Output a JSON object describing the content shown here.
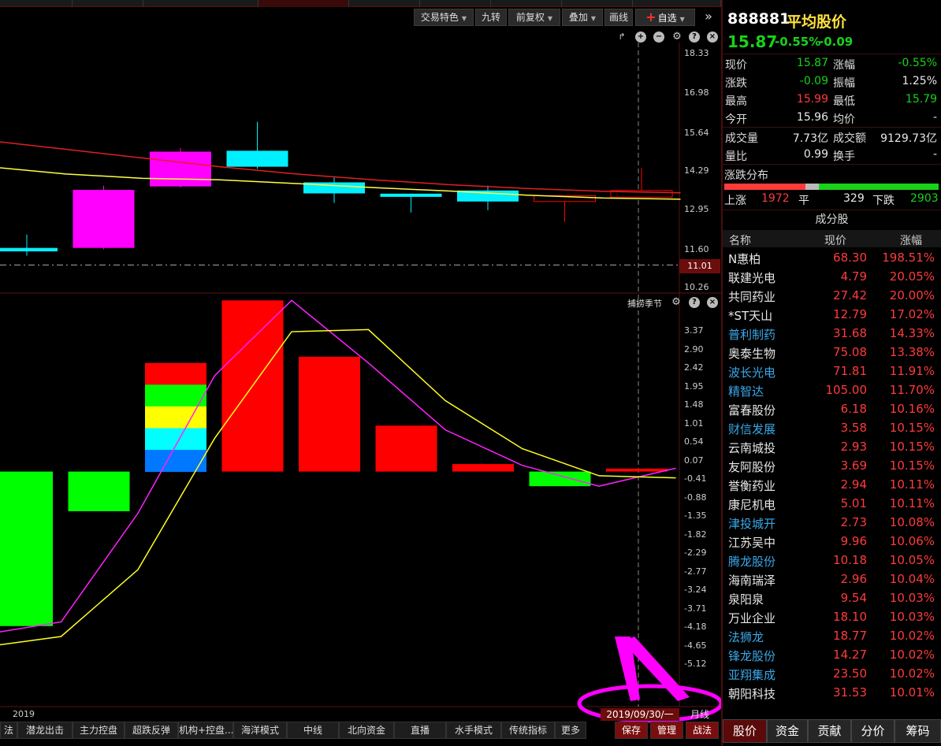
{
  "toolbar": {
    "trade_features": "交易特色",
    "nine_turns": "九转",
    "adjust": "前复权",
    "overlay": "叠加",
    "draw_line": "画线",
    "watchlist": "自选"
  },
  "price_axis": [
    "18.33",
    "16.98",
    "15.64",
    "14.29",
    "12.95",
    "11.60",
    "10.26"
  ],
  "current_price_tag": "11.01",
  "indicator": {
    "name": "捕捞季节",
    "axis": [
      "3.37",
      "2.90",
      "2.42",
      "1.95",
      "1.48",
      "1.01",
      "0.54",
      "0.07",
      "-0.41",
      "-0.88",
      "-1.35",
      "-1.82",
      "-2.29",
      "-2.77",
      "-3.24",
      "-3.71",
      "-4.18",
      "-4.65",
      "-5.12"
    ]
  },
  "timeline": {
    "year_label": "2019",
    "cursor_date": "2019/09/30/一",
    "period": "月线"
  },
  "bottom_tabs": [
    "法",
    "潜龙出击",
    "主力控盘",
    "超跌反弹",
    "机构+控盘...",
    "海洋模式",
    "中线",
    "北向资金",
    "直播",
    "水手模式",
    "传统指标",
    "更多"
  ],
  "bottom_actions": [
    "保存",
    "管理",
    "战法"
  ],
  "right_tabs": [
    "股价",
    "资金",
    "贡献",
    "分价",
    "筹码"
  ],
  "quote": {
    "code": "888881",
    "name": "平均股价",
    "price": "15.87",
    "change_pct": "-0.55%",
    "change": "-0.09",
    "stats": [
      {
        "l1": "现价",
        "v1": "15.87",
        "c1": "g",
        "l2": "涨幅",
        "v2": "-0.55%",
        "c2": "g"
      },
      {
        "l1": "涨跌",
        "v1": "-0.09",
        "c1": "g",
        "l2": "振幅",
        "v2": "1.25%",
        "c2": "w"
      },
      {
        "l1": "最高",
        "v1": "15.99",
        "c1": "r",
        "l2": "最低",
        "v2": "15.79",
        "c2": "g"
      },
      {
        "l1": "今开",
        "v1": "15.96",
        "c1": "w",
        "l2": "均价",
        "v2": "-",
        "c2": "w"
      }
    ],
    "stats2": [
      {
        "l1": "成交量",
        "v1": "7.73亿",
        "c1": "w",
        "l2": "成交额",
        "v2": "9129.73亿",
        "c2": "w"
      },
      {
        "l1": "量比",
        "v1": "0.99",
        "c1": "w",
        "l2": "换手",
        "v2": "-",
        "c2": "w"
      }
    ]
  },
  "distribution": {
    "title": "涨跌分布",
    "up_label": "上涨",
    "up": "1972",
    "flat_label": "平",
    "flat": "329",
    "down_label": "下跌",
    "down": "2903",
    "up_frac": 0.379,
    "flat_frac": 0.063,
    "down_frac": 0.558
  },
  "constituents": {
    "title": "成分股",
    "headers": [
      "名称",
      "现价",
      "涨幅"
    ],
    "rows": [
      {
        "name": "N惠柏",
        "price": "68.30",
        "pct": "198.51%",
        "color": "white"
      },
      {
        "name": "联建光电",
        "price": "4.79",
        "pct": "20.05%",
        "color": "white"
      },
      {
        "name": "共同药业",
        "price": "27.42",
        "pct": "20.00%",
        "color": "white"
      },
      {
        "name": "*ST天山",
        "price": "12.79",
        "pct": "17.02%",
        "color": "white"
      },
      {
        "name": "普利制药",
        "price": "31.68",
        "pct": "14.33%",
        "color": "blue"
      },
      {
        "name": "奥泰生物",
        "price": "75.08",
        "pct": "13.38%",
        "color": "white"
      },
      {
        "name": "波长光电",
        "price": "71.81",
        "pct": "11.91%",
        "color": "blue"
      },
      {
        "name": "精智达",
        "price": "105.00",
        "pct": "11.70%",
        "color": "blue"
      },
      {
        "name": "富春股份",
        "price": "6.18",
        "pct": "10.16%",
        "color": "white"
      },
      {
        "name": "财信发展",
        "price": "3.58",
        "pct": "10.15%",
        "color": "blue"
      },
      {
        "name": "云南城投",
        "price": "2.93",
        "pct": "10.15%",
        "color": "white"
      },
      {
        "name": "友阿股份",
        "price": "3.69",
        "pct": "10.15%",
        "color": "white"
      },
      {
        "name": "誉衡药业",
        "price": "2.94",
        "pct": "10.11%",
        "color": "white"
      },
      {
        "name": "康尼机电",
        "price": "5.01",
        "pct": "10.11%",
        "color": "white"
      },
      {
        "name": "津投城开",
        "price": "2.73",
        "pct": "10.08%",
        "color": "blue"
      },
      {
        "name": "江苏吴中",
        "price": "9.96",
        "pct": "10.06%",
        "color": "white"
      },
      {
        "name": "腾龙股份",
        "price": "10.18",
        "pct": "10.05%",
        "color": "blue"
      },
      {
        "name": "海南瑞泽",
        "price": "2.96",
        "pct": "10.04%",
        "color": "white"
      },
      {
        "name": "泉阳泉",
        "price": "9.54",
        "pct": "10.03%",
        "color": "white"
      },
      {
        "name": "万业企业",
        "price": "18.10",
        "pct": "10.03%",
        "color": "white"
      },
      {
        "name": "法狮龙",
        "price": "18.77",
        "pct": "10.02%",
        "color": "blue"
      },
      {
        "name": "锋龙股份",
        "price": "14.27",
        "pct": "10.02%",
        "color": "blue"
      },
      {
        "name": "亚翔集成",
        "price": "23.50",
        "pct": "10.02%",
        "color": "blue"
      },
      {
        "name": "朝阳科技",
        "price": "31.53",
        "pct": "10.01%",
        "color": "white"
      }
    ]
  },
  "colors": {
    "up": "#ff3b3b",
    "down": "#19d219",
    "accent": "#ff00ff",
    "ma_red": "#e02020",
    "ma_yellow": "#ffff40"
  },
  "chart_data": [
    {
      "type": "candlestick",
      "ylim": [
        10.26,
        18.33
      ],
      "candles": [
        {
          "o": 11.6,
          "c": 11.48,
          "h": 12.06,
          "l": 11.33,
          "col": "cyan"
        },
        {
          "o": 11.6,
          "c": 13.6,
          "h": 13.75,
          "l": 11.55,
          "col": "magenta"
        },
        {
          "o": 13.72,
          "c": 14.92,
          "h": 15.05,
          "l": 13.68,
          "col": "magenta"
        },
        {
          "o": 14.95,
          "c": 14.4,
          "h": 15.95,
          "l": 14.33,
          "col": "cyan"
        },
        {
          "o": 13.86,
          "c": 13.48,
          "h": 14.03,
          "l": 13.15,
          "col": "cyan"
        },
        {
          "o": 13.47,
          "c": 13.36,
          "h": 13.47,
          "l": 12.82,
          "col": "cyan"
        },
        {
          "o": 13.58,
          "c": 13.2,
          "h": 13.75,
          "l": 12.9,
          "col": "cyan"
        },
        {
          "o": 13.2,
          "c": 13.4,
          "h": 13.4,
          "l": 12.5,
          "col": "red"
        },
        {
          "o": 13.35,
          "c": 13.58,
          "h": 14.36,
          "l": 13.35,
          "col": "red"
        }
      ],
      "ma_red": [
        15.3,
        15.0,
        14.7,
        14.4,
        14.15,
        13.95,
        13.78,
        13.65,
        13.55,
        13.5
      ],
      "ma_yellow": [
        14.4,
        14.15,
        14.0,
        13.95,
        13.82,
        13.68,
        13.56,
        13.42,
        13.32,
        13.28
      ],
      "ref_price": 11.01
    },
    {
      "type": "bar",
      "ylim": [
        -5.12,
        3.37
      ],
      "bars": [
        {
          "v": -3.7,
          "col": "green"
        },
        {
          "v": -0.95,
          "col": "green"
        },
        {
          "v": 2.6,
          "col": "rainbow"
        },
        {
          "v": 4.1,
          "col": "red"
        },
        {
          "v": 2.75,
          "col": "red"
        },
        {
          "v": 1.1,
          "col": "red"
        },
        {
          "v": 0.18,
          "col": "red"
        },
        {
          "v": -0.35,
          "col": "green"
        },
        {
          "v": 0.07,
          "col": "red"
        }
      ],
      "line_magenta": [
        -3.9,
        -3.6,
        -1.0,
        2.3,
        4.1,
        2.6,
        1.0,
        0.15,
        -0.35,
        0.08
      ],
      "line_yellow": [
        -4.2,
        -3.95,
        -2.35,
        0.8,
        3.35,
        3.4,
        1.7,
        0.55,
        -0.1,
        -0.15
      ]
    }
  ]
}
